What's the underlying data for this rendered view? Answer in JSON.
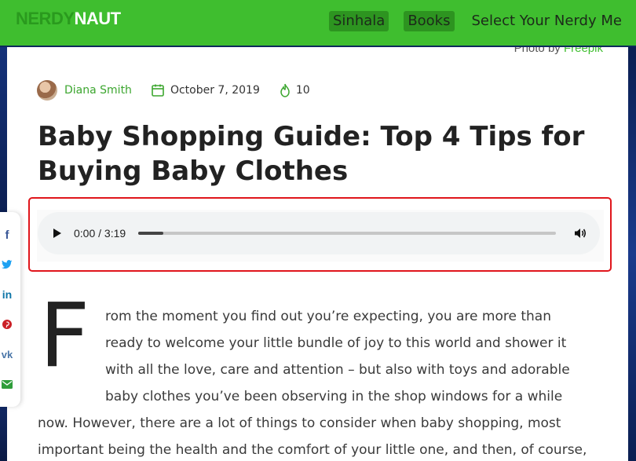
{
  "header": {
    "logo_part1": "NERDY",
    "logo_part2": "NAUT",
    "nav": [
      "Sinhala",
      "Books"
    ],
    "nav_more": "Select Your Nerdy Me"
  },
  "photo_credit": {
    "prefix": "Photo by ",
    "source": "Freepik"
  },
  "meta": {
    "author": "Diana Smith",
    "date": "October 7, 2019",
    "views": "10",
    "icons": [
      "calendar-icon",
      "fire-icon"
    ]
  },
  "article": {
    "title": "Baby Shopping Guide: Top 4 Tips for Buying Baby Clothes",
    "dropcap": "F",
    "lines": [
      "rom the moment you find out you’re expecting, you are more than",
      "ready to welcome your little bundle of joy to this world and shower it",
      "with all the love, care and attention – but also with toys and adorable",
      "baby clothes you’ve been observing in the shop windows for a while",
      "now. However, there are a lot of things to consider when baby shopping, most",
      "important being the health and the comfort of your little one, and then, of course,"
    ]
  },
  "audio": {
    "time": "0:00 / 3:19",
    "progress": 0.06
  },
  "share": [
    "facebook-icon",
    "twitter-icon",
    "linkedin-icon",
    "pinterest-icon",
    "vk-icon",
    "email-icon"
  ],
  "colors": {
    "brand_green": "#3fbe2f",
    "highlight_red": "#e0161c"
  }
}
